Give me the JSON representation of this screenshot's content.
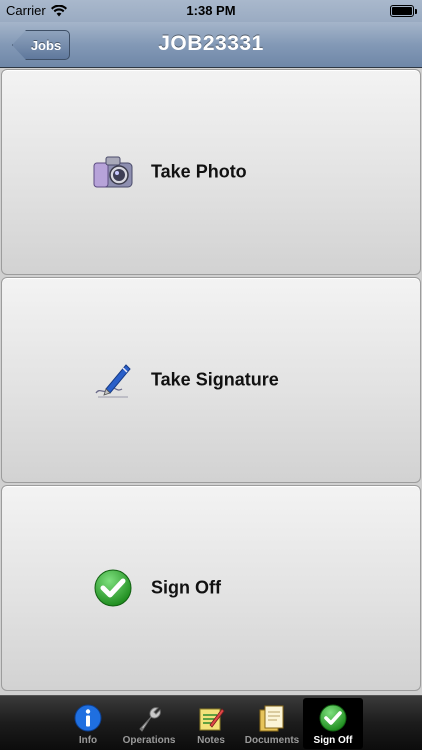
{
  "status_bar": {
    "carrier": "Carrier",
    "time": "1:38 PM"
  },
  "nav": {
    "back_label": "Jobs",
    "title": "JOB23331"
  },
  "actions": [
    {
      "label": "Take Photo",
      "icon": "camera-icon"
    },
    {
      "label": "Take Signature",
      "icon": "pen-signature-icon"
    },
    {
      "label": "Sign Off",
      "icon": "checkmark-icon"
    }
  ],
  "tabs": [
    {
      "label": "Info",
      "icon": "info-icon",
      "selected": false
    },
    {
      "label": "Operations",
      "icon": "wrench-icon",
      "selected": false
    },
    {
      "label": "Notes",
      "icon": "notepad-icon",
      "selected": false
    },
    {
      "label": "Documents",
      "icon": "documents-icon",
      "selected": false
    },
    {
      "label": "Sign Off",
      "icon": "checkmark-icon",
      "selected": true
    }
  ],
  "colors": {
    "nav_bar": "#8399b6",
    "checkmark_green": "#2fa52f",
    "info_blue": "#1f6fe0"
  }
}
